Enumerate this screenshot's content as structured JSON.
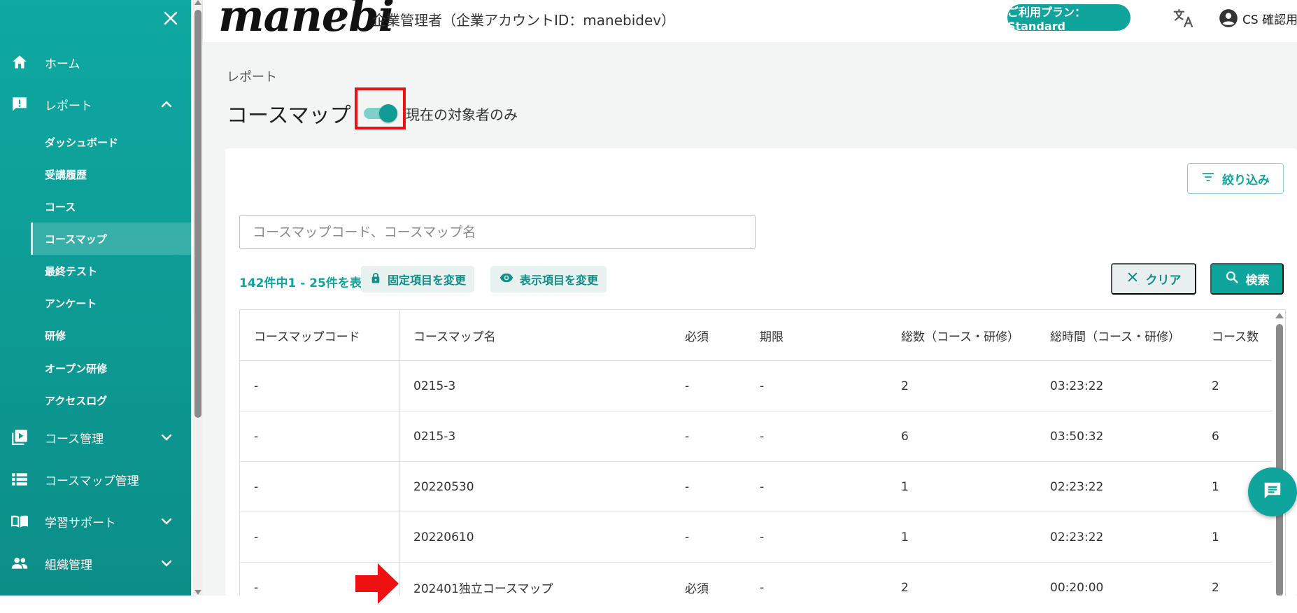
{
  "sidebar": {
    "items": [
      {
        "label": "ホーム"
      },
      {
        "label": "レポート"
      },
      {
        "label": "コース管理"
      },
      {
        "label": "コースマップ管理"
      },
      {
        "label": "学習サポート"
      },
      {
        "label": "組織管理"
      }
    ],
    "report_sub": [
      "ダッシュボード",
      "受講履歴",
      "コース",
      "コースマップ",
      "最終テスト",
      "アンケート",
      "研修",
      "オープン研修",
      "アクセスログ"
    ]
  },
  "header": {
    "logo": "manebi",
    "account": "企業管理者（企業アカウントID：manebidev）",
    "plan": "ご利用プラン：Standard",
    "user": "CS 確認用"
  },
  "main": {
    "breadcrumb": "レポート",
    "title": "コースマップ",
    "toggle_label": "現在の対象者のみ",
    "toggle_on": true,
    "filter_label": "絞り込み",
    "search_placeholder": "コースマップコード、コースマップ名",
    "count_text": "142件中1 - 25件を表示",
    "fixed_items_label": "固定項目を変更",
    "display_items_label": "表示項目を変更",
    "clear_label": "クリア",
    "search_label": "検索"
  },
  "table": {
    "columns": [
      "コースマップコード",
      "コースマップ名",
      "必須",
      "期限",
      "総数（コース・研修）",
      "総時間（コース・研修）",
      "コース数"
    ],
    "rows": [
      [
        "-",
        "0215-3",
        "-",
        "-",
        "2",
        "03:23:22",
        "2"
      ],
      [
        "-",
        "0215-3",
        "-",
        "-",
        "6",
        "03:50:32",
        "6"
      ],
      [
        "-",
        "20220530",
        "-",
        "-",
        "1",
        "02:23:22",
        "1"
      ],
      [
        "-",
        "20220610",
        "-",
        "-",
        "1",
        "02:23:22",
        "1"
      ],
      [
        "-",
        "202401独立コースマップ",
        "必須",
        "-",
        "2",
        "00:20:00",
        "2"
      ]
    ]
  },
  "colors": {
    "accent": "#0fa59d",
    "highlight": "#ee1111"
  }
}
